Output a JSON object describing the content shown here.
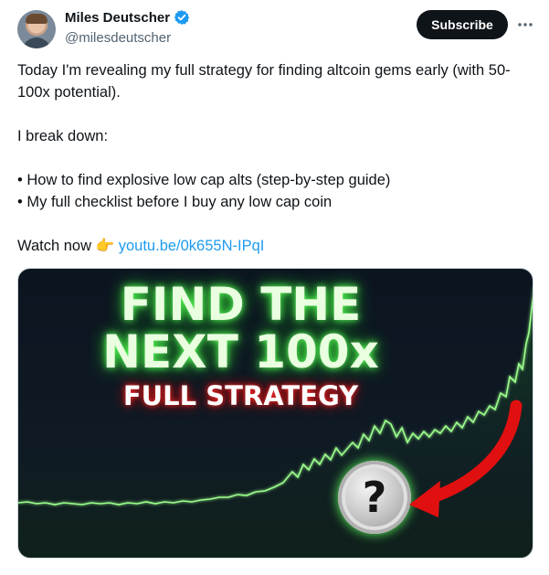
{
  "author": {
    "name": "Miles Deutscher",
    "handle": "@milesdeutscher"
  },
  "actions": {
    "subscribe_label": "Subscribe",
    "more_icon": "more-horizontal-icon"
  },
  "post": {
    "line1": "Today I'm revealing my full strategy for finding altcoin gems early (with 50-100x potential).",
    "line2": "I break down:",
    "bullet1": "• How to find explosive low cap alts (step-by-step guide)",
    "bullet2": "• My full checklist before I buy any low cap coin",
    "watch_prefix": "Watch now",
    "watch_emoji": "👉",
    "link_text": "youtu.be/0k655N-IPqI"
  },
  "thumbnail": {
    "headline_1": "FIND THE",
    "headline_2": "NEXT 100x",
    "subheadline": "FULL STRATEGY",
    "coin_symbol": "?"
  },
  "colors": {
    "brand_link": "#1d9bf0",
    "verified": "#1d9bf0",
    "glow_green": "#5dff5d",
    "arrow_red": "#e01010"
  }
}
